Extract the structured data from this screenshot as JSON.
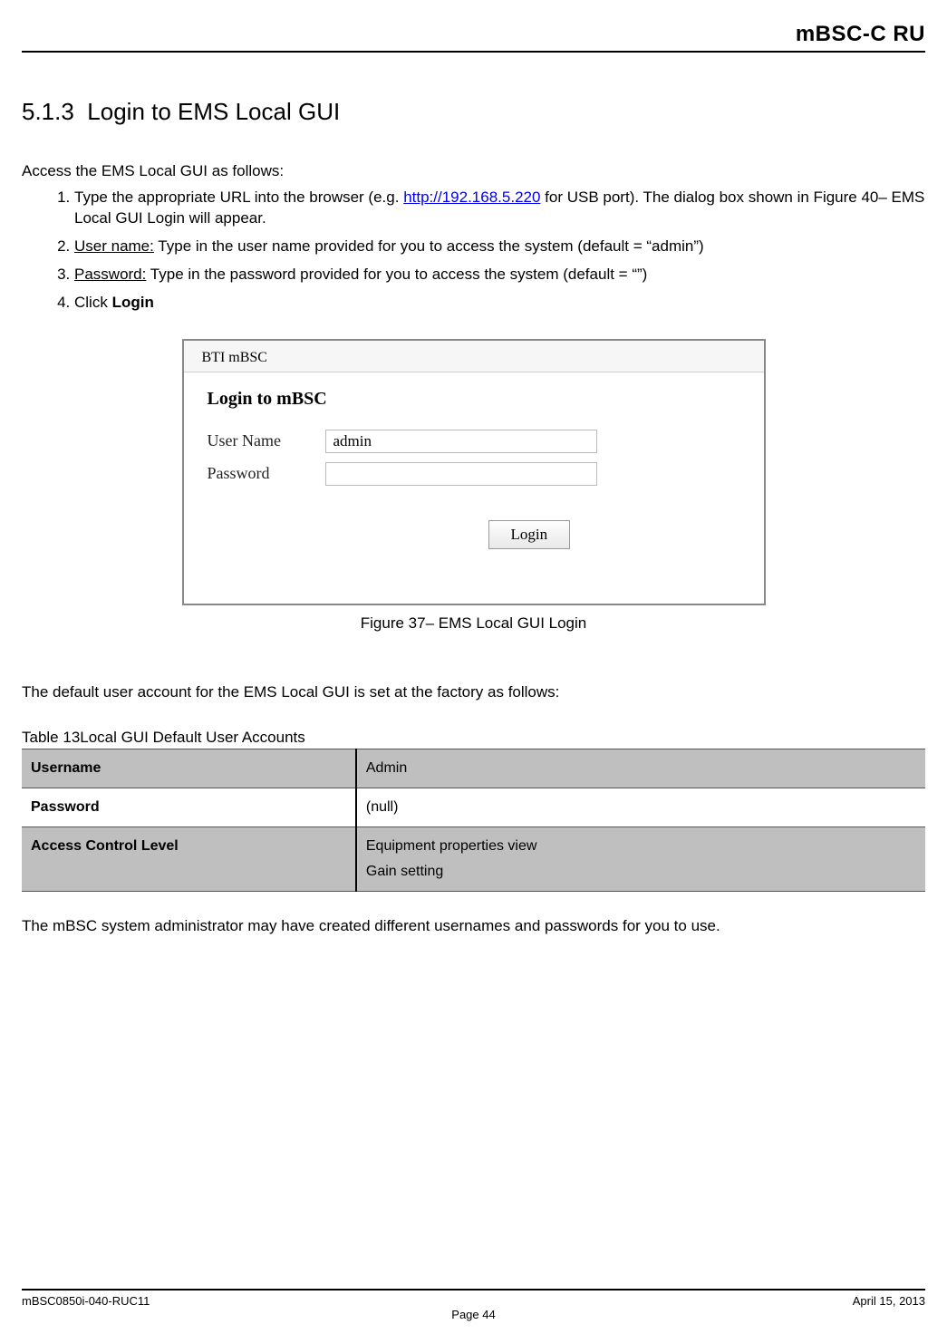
{
  "header": {
    "right": "mBSC-C   RU"
  },
  "section": {
    "number": "5.1.3",
    "title": "Login to EMS Local GUI"
  },
  "intro": "Access the EMS Local GUI as follows:",
  "steps": {
    "s1_pre": "Type the appropriate URL into the browser (e.g. ",
    "s1_link": "http://192.168.5.220",
    "s1_post": " for USB port). The dialog box shown in Figure 40– EMS Local GUI Login will appear.",
    "s2_label": "User name:",
    "s2_text": " Type in the user name provided for you to access the system (default = “admin”)",
    "s3_label": "Password:",
    "s3_text": " Type in the password provided for you to access the system (default = “”)",
    "s4_pre": "Click ",
    "s4_bold": "Login"
  },
  "login": {
    "tab": "BTI mBSC",
    "heading": "Login to mBSC",
    "user_label": "User Name",
    "user_value": "admin",
    "pass_label": "Password",
    "pass_value": "",
    "button": "Login"
  },
  "figure_caption": "Figure 37– EMS Local GUI Login",
  "para_default": "The default user account for the EMS Local GUI is set at the factory as follows:",
  "table_title": "Table 13Local GUI Default User Accounts",
  "table": {
    "r1k": "Username",
    "r1v": "Admin",
    "r2k": "Password",
    "r2v": "(null)",
    "r3k": "Access Control Level",
    "r3v1": "Equipment properties view",
    "r3v2": "Gain setting"
  },
  "para_admin": "The mBSC system administrator may have created different usernames and passwords for you to use.",
  "footer": {
    "left": "mBSC0850i-040-RUC11",
    "right": "April 15, 2013",
    "page": "Page 44"
  }
}
